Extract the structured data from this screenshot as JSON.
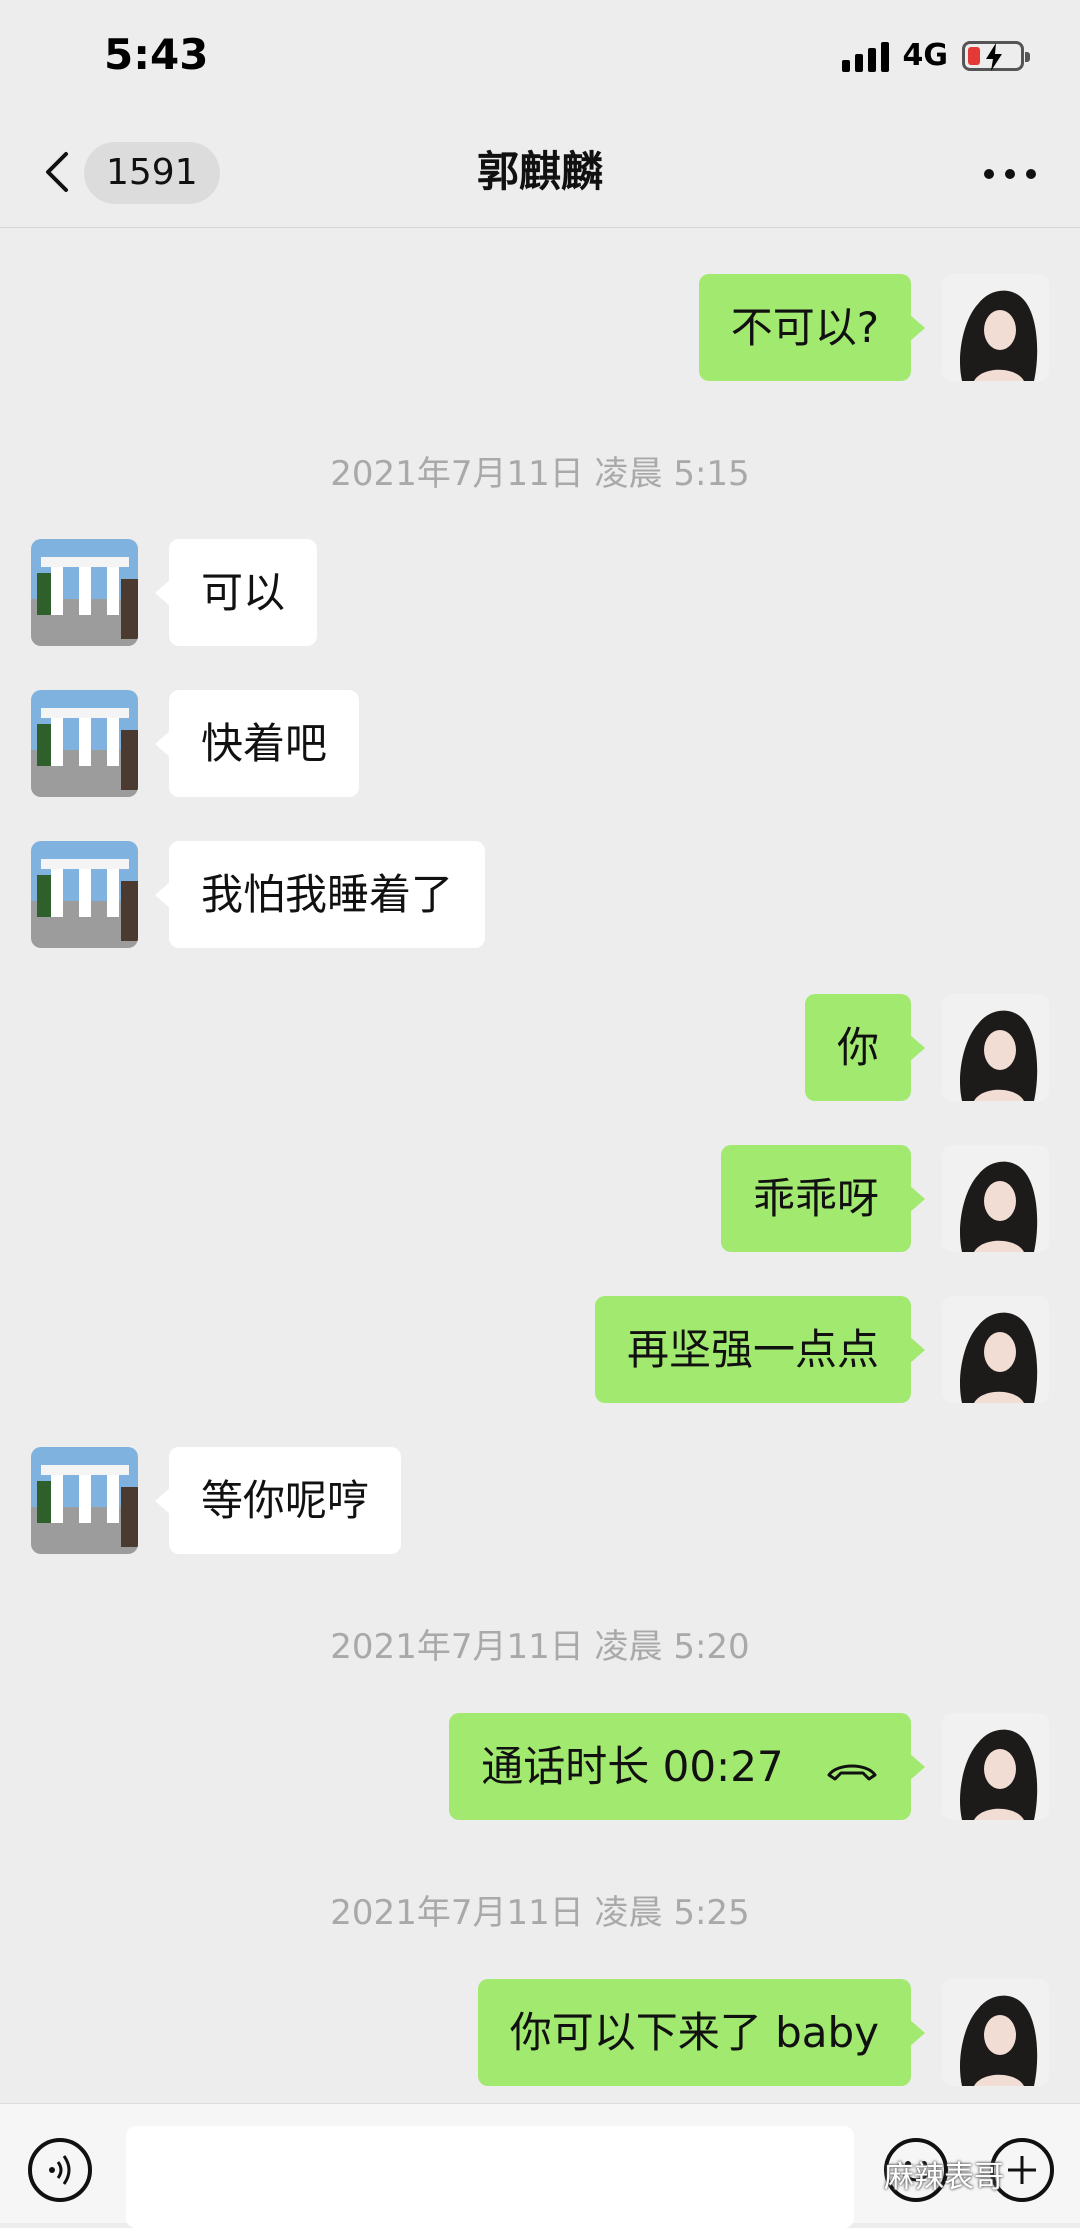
{
  "status_bar": {
    "time": "5:43",
    "network": "4G"
  },
  "nav": {
    "badge_count": "1591",
    "title": "郭麒麟"
  },
  "messages": [
    {
      "side": "out",
      "text": "不可以?"
    },
    {
      "side": "in",
      "text": "可以"
    },
    {
      "side": "in",
      "text": "快着吧"
    },
    {
      "side": "in",
      "text": "我怕我睡着了"
    },
    {
      "side": "out",
      "text": "你"
    },
    {
      "side": "out",
      "text": "乖乖呀"
    },
    {
      "side": "out",
      "text": "再坚强一点点"
    },
    {
      "side": "in",
      "text": "等你呢哼"
    },
    {
      "side": "out",
      "text": "通话时长 00:27"
    },
    {
      "side": "out",
      "text": "你可以下来了 baby"
    }
  ],
  "timestamps": [
    "2021年7月11日 凌晨 5:15",
    "2021年7月11日 凌晨 5:20",
    "2021年7月11日 凌晨 5:25"
  ],
  "watermark": "麻辣表哥",
  "colors": {
    "outgoing_bubble": "#a1e96f",
    "incoming_bubble": "#ffffff",
    "background": "#ededed"
  }
}
